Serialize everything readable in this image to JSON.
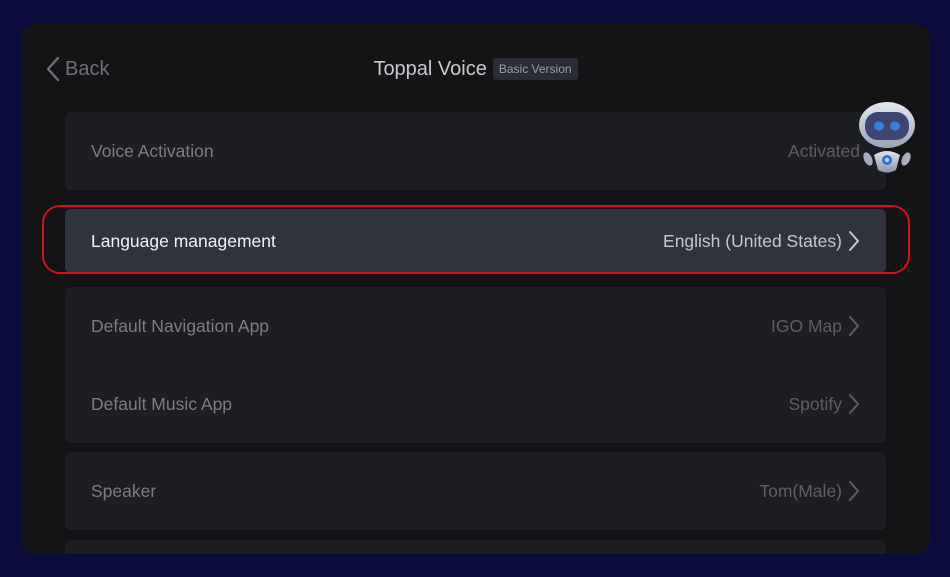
{
  "header": {
    "back_label": "Back",
    "title": "Toppal Voice",
    "badge": "Basic Version"
  },
  "settings": {
    "voice_activation": {
      "label": "Voice Activation",
      "value": "Activated"
    },
    "language": {
      "label": "Language management",
      "value": "English (United States)"
    },
    "navigation_app": {
      "label": "Default Navigation App",
      "value": "IGO Map"
    },
    "music_app": {
      "label": "Default Music App",
      "value": "Spotify"
    },
    "speaker": {
      "label": "Speaker",
      "value": "Tom(Male)"
    }
  },
  "icons": {
    "back": "chevron-left-icon",
    "row_arrow": "chevron-right-icon",
    "assistant": "robot-icon"
  },
  "colors": {
    "background": "#0b0c3c",
    "panel": "#141416",
    "card": "#1d1e22",
    "highlight_card": "#30323c",
    "highlight_frame": "#d0121b"
  }
}
